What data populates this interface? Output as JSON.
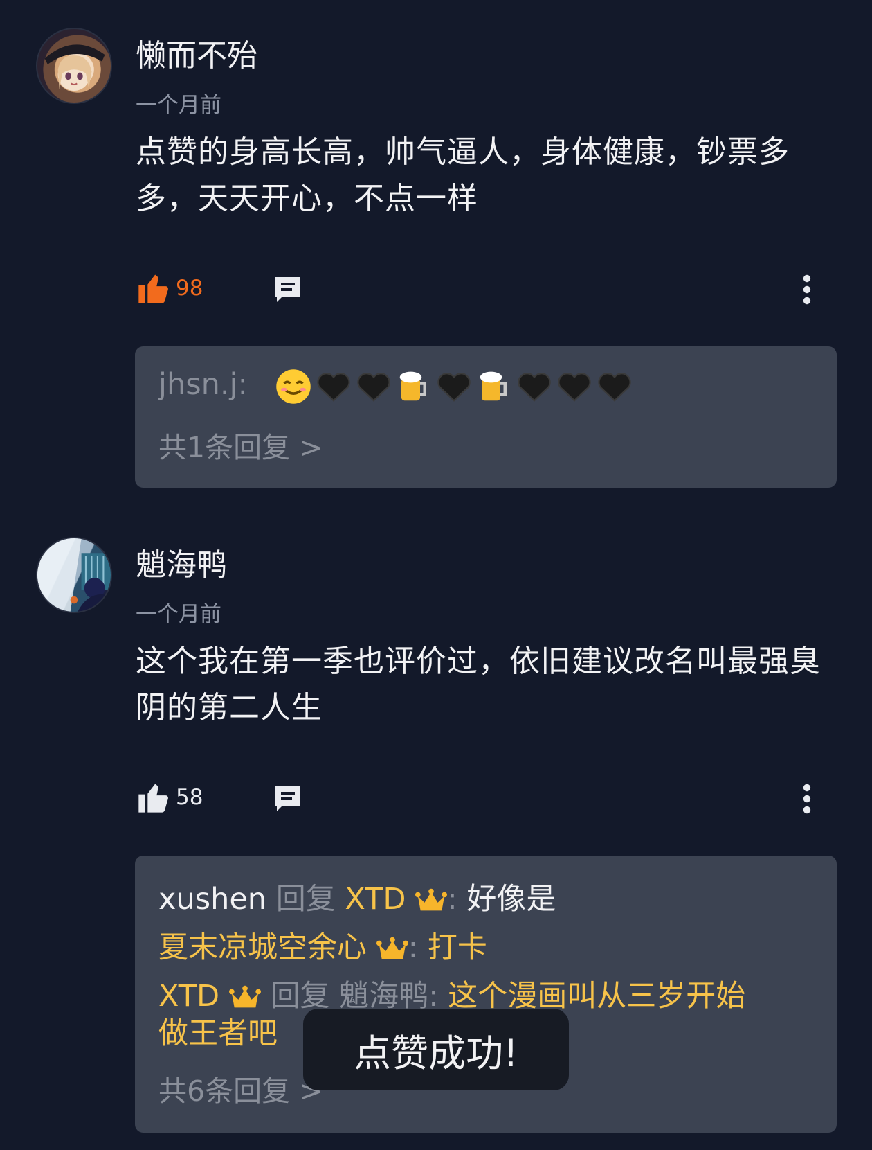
{
  "comments": [
    {
      "username": "懒而不殆",
      "time": "一个月前",
      "body": "点赞的身高长高，帅气逼人，身体健康，钞票多多，天天开心，不点一样",
      "likes": "98",
      "liked": true,
      "replies": {
        "lines": [
          {
            "user": "jhsn.j",
            "sep": ":",
            "emojis": [
              "smiling-face",
              "black-heart",
              "black-heart",
              "beer-mug",
              "black-heart",
              "beer-mug",
              "black-heart",
              "black-heart",
              "black-heart"
            ]
          }
        ],
        "more": "共1条回复 >"
      }
    },
    {
      "username": "魈海鸭",
      "time": "一个月前",
      "body": "这个我在第一季也评价过，依旧建议改名叫最强臭阴的第二人生",
      "likes": "58",
      "liked": false,
      "replies": {
        "line1": {
          "user": "xushen",
          "reply_word": "回复",
          "target": "XTD",
          "sep": ":",
          "text": "好像是"
        },
        "line2": {
          "user": "夏末凉城空余心",
          "sep": ":",
          "text": "打卡"
        },
        "line3": {
          "user": "XTD",
          "reply_word": "回复",
          "target": "魈海鸭",
          "sep": ":",
          "text_a": "这个漫画叫从三岁开始",
          "text_b": "做王者吧"
        },
        "more": "共6条回复 >"
      }
    }
  ],
  "toast": "点赞成功!",
  "colors": {
    "background": "#13192a",
    "reply_box": "#3c4352",
    "liked": "#f26b1d",
    "vip_gold": "#f7c34a",
    "muted": "#8a8f9a"
  }
}
